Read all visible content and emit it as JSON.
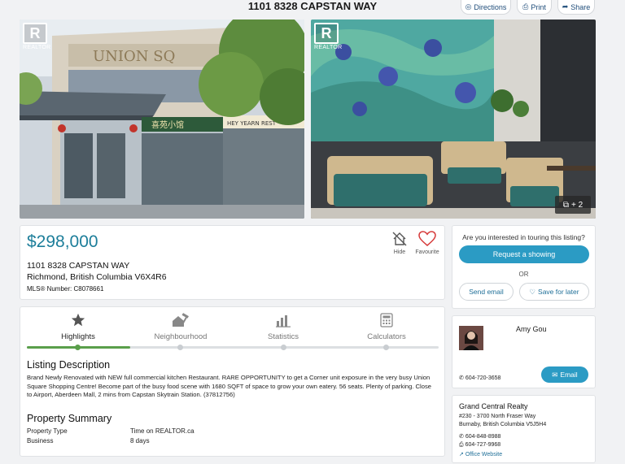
{
  "header": {
    "title": "1101 8328 CAPSTAN WAY",
    "directions_label": "Directions",
    "print_label": "Print",
    "share_label": "Share"
  },
  "photos": {
    "watermark_text": "REALTOR",
    "more_count": "+ 2",
    "storefront_sign": "UNION SQ",
    "restaurant_sign": "喜苑小馆",
    "restaurant_sign_en": "HEY YEARN REST"
  },
  "listing": {
    "price": "$298,000",
    "address_line1": "1101 8328 CAPSTAN WAY",
    "address_line2": "Richmond, British Columbia V6X4R6",
    "mls_label": "MLS® Number: C8078661",
    "hide_label": "Hide",
    "favourite_label": "Favourite"
  },
  "showing": {
    "question": "Are you interested in touring this listing?",
    "request_label": "Request a showing",
    "or_label": "OR",
    "send_email_label": "Send email",
    "save_label": "Save for later"
  },
  "tabs": [
    {
      "label": "Highlights",
      "icon": "star-icon"
    },
    {
      "label": "Neighbourhood",
      "icon": "hammer-house-icon"
    },
    {
      "label": "Statistics",
      "icon": "bar-chart-icon"
    },
    {
      "label": "Calculators",
      "icon": "calculator-icon"
    }
  ],
  "description": {
    "heading": "Listing Description",
    "text": "Brand Newly Renovated with NEW full commercial kitchen Restaurant. RARE OPPORTUNITY to get a Corner unit exposure in the very busy Union Square Shopping Centre! Become part of the busy food scene with 1680 SQFT of space to grow your own eatery. 56 seats. Plenty of parking. Close to Airport, Aberdeen Mall, 2 mins from Capstan Skytrain Station. (37812756)"
  },
  "summary": {
    "heading": "Property Summary",
    "rows": [
      {
        "label": "Property Type",
        "value": "Business"
      },
      {
        "label": "Time on REALTOR.ca",
        "value": "8 days"
      }
    ]
  },
  "agent": {
    "name": "Amy Gou",
    "phone": "604-720-3658",
    "email_label": "Email"
  },
  "brokerage": {
    "name": "Grand Central Realty",
    "address1": "#230 - 3700 North Fraser Way",
    "address2": "Burnaby, British Columbia V5J5H4",
    "phone": "604-848-8988",
    "fax": "604-727-9968",
    "website_label": "Office Website"
  },
  "colors": {
    "accent": "#2b9bc4",
    "price": "#1d7e9a",
    "progress": "#5a9f4b"
  }
}
